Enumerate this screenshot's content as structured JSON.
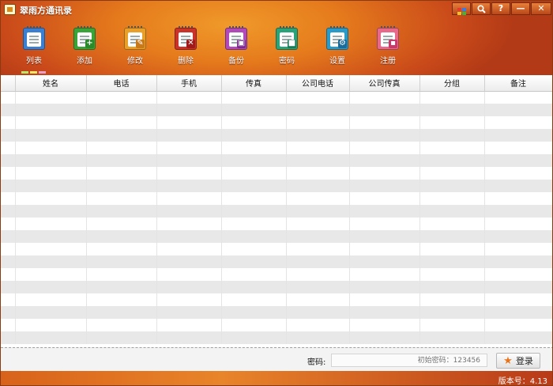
{
  "window": {
    "title": "翠雨方通讯录"
  },
  "window_controls": [
    {
      "name": "skin",
      "glyph": ""
    },
    {
      "name": "search",
      "glyph": "🔍"
    },
    {
      "name": "help",
      "glyph": "?"
    },
    {
      "name": "minimize",
      "glyph": "—"
    },
    {
      "name": "close",
      "glyph": "✕"
    }
  ],
  "toolbar": [
    {
      "label": "列表",
      "icon": "list-icon",
      "color": "#3a7fd0"
    },
    {
      "label": "添加",
      "icon": "add-icon",
      "color": "#3aa43a"
    },
    {
      "label": "修改",
      "icon": "edit-icon",
      "color": "#e8a02a"
    },
    {
      "label": "删除",
      "icon": "delete-icon",
      "color": "#c8342a"
    },
    {
      "label": "备份",
      "icon": "backup-icon",
      "color": "#b04ab8"
    },
    {
      "label": "密码",
      "icon": "password-icon",
      "color": "#2aa27a"
    },
    {
      "label": "设置",
      "icon": "settings-icon",
      "color": "#2a9ac8"
    },
    {
      "label": "注册",
      "icon": "register-icon",
      "color": "#e86a8a"
    }
  ],
  "table": {
    "columns": [
      "姓名",
      "电话",
      "手机",
      "传真",
      "公司电话",
      "公司传真",
      "分组",
      "备注"
    ],
    "rows": []
  },
  "login": {
    "label": "密码:",
    "placeholder": "初始密码：123456",
    "button": "登录"
  },
  "status": {
    "version": "版本号：4.13"
  },
  "colors": {
    "accent": "#e57a1c",
    "header_dark": "#b23a16",
    "row_stripe": "#e8e8e8"
  }
}
